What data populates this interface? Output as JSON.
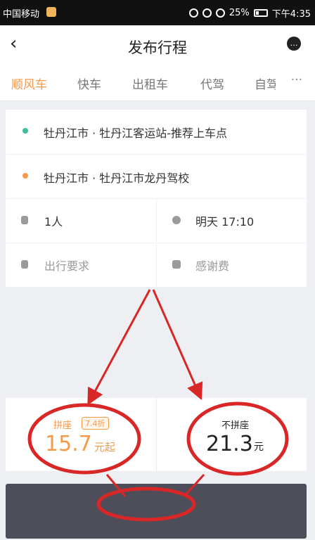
{
  "status_bar": {
    "carrier": "中国移动",
    "battery": "25%",
    "time": "下午4:35"
  },
  "header": {
    "title": "发布行程"
  },
  "tabs": [
    {
      "label": "顺风车"
    },
    {
      "label": "快车"
    },
    {
      "label": "出租车"
    },
    {
      "label": "代驾"
    },
    {
      "label": "自驾"
    }
  ],
  "route": {
    "origin": "牡丹江市 · 牡丹江客运站-推荐上车点",
    "destination": "牡丹江市 · 牡丹江市龙丹驾校",
    "passengers": "1人",
    "time": "明天 17:10",
    "requirements_placeholder": "出行要求",
    "thanks_fee_placeholder": "感谢费"
  },
  "price": {
    "carpool_label": "拼座",
    "discount": "7.4折",
    "carpool_price": "15.7",
    "carpool_unit": "元起",
    "no_carpool_label": "不拼座",
    "no_carpool_price": "21.3",
    "no_carpool_unit": "元"
  },
  "colors": {
    "accent": "#f39a4b",
    "button": "#4d4e59",
    "annotation": "#d92626"
  }
}
